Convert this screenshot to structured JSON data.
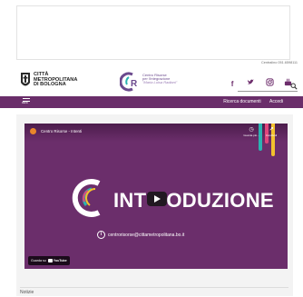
{
  "header": {
    "centralino": "Centralino 051.6598111",
    "cmb_logo": {
      "line1": "CITTÀ",
      "line2": "METROPOLITANA",
      "line3": "DI BOLOGNA"
    },
    "cr_logo": {
      "line1": "Centro Risorse",
      "line2": "per l'integrazione",
      "line3": "\"Maria Luisa Radiani\""
    },
    "social_icons": [
      "facebook-icon",
      "twitter-icon",
      "instagram-icon",
      "youtube-icon"
    ],
    "search_icon": "search-icon"
  },
  "nav": {
    "menu_label": "MENU",
    "links": [
      "Ricerca documenti",
      "Accedi"
    ]
  },
  "video": {
    "channel_title": "Centro Risorse - Intenti",
    "intro_left": "INT",
    "intro_right": "ODUZIONE",
    "email": "centrorisorse@cittametropolitana.bo.it",
    "watch_later": "Guarda più...",
    "share": "Condividi",
    "watch_on_label": "Guarda su",
    "youtube_label": "YouTube",
    "colors": {
      "background": "#6b2e6b",
      "stripe_teal": "#2bb3b1",
      "stripe_pink": "#e0457b",
      "stripe_yellow": "#f2c12e"
    }
  },
  "section": {
    "notizie": "Notizie"
  },
  "colors": {
    "nav_bg": "#6a2e6a",
    "accent": "#6d2d6c"
  }
}
